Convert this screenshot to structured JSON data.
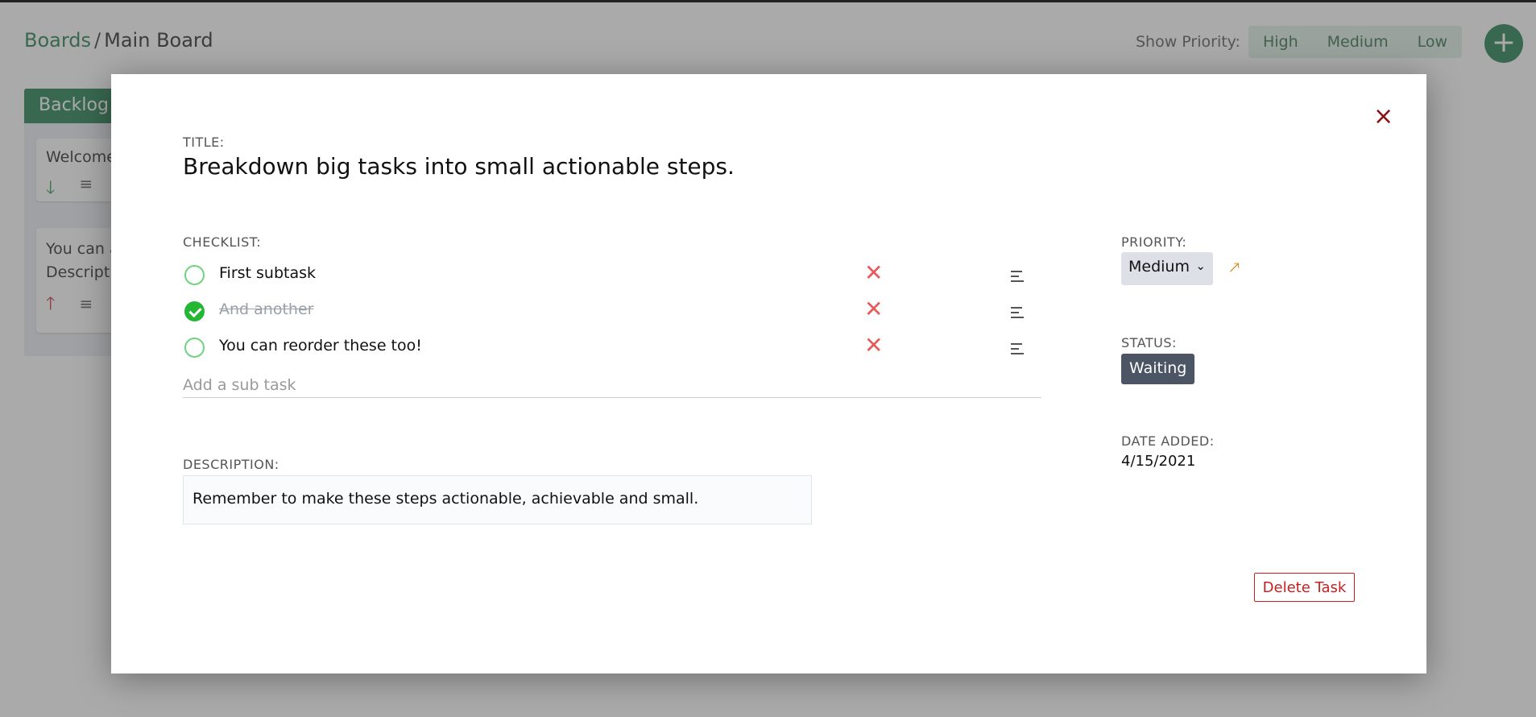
{
  "breadcrumb": {
    "root": "Boards",
    "separator": "/",
    "current": "Main Board"
  },
  "priority_filter": {
    "label": "Show Priority:",
    "options": [
      "High",
      "Medium",
      "Low"
    ]
  },
  "add_button": {
    "label": "+"
  },
  "board": {
    "column": {
      "title": "Backlog",
      "cards": [
        {
          "text": "Welcome t",
          "priority": "low"
        },
        {
          "text": "You can ad\nDescriptio",
          "priority": "high"
        }
      ]
    }
  },
  "modal": {
    "close_label": "×",
    "title_label": "TITLE:",
    "title": "Breakdown big tasks into small actionable steps.",
    "checklist_label": "CHECKLIST:",
    "checklist": [
      {
        "text": "First subtask",
        "done": false
      },
      {
        "text": "And another",
        "done": true
      },
      {
        "text": "You can reorder these too!",
        "done": false
      }
    ],
    "add_subtask_placeholder": "Add a sub task",
    "description_label": "DESCRIPTION:",
    "description": "Remember to make these steps actionable, achievable and small.",
    "priority_label": "PRIORITY:",
    "priority_value": "Medium",
    "status_label": "STATUS:",
    "status_value": "Waiting",
    "date_label": "DATE ADDED:",
    "date_value": "4/15/2021",
    "delete_label": "Delete Task"
  },
  "colors": {
    "brand_green": "#1b7a4b",
    "danger": "#c62020",
    "check_green": "#26b636",
    "priority_medium": "#d98a1b",
    "status_bg": "#4b5563"
  }
}
